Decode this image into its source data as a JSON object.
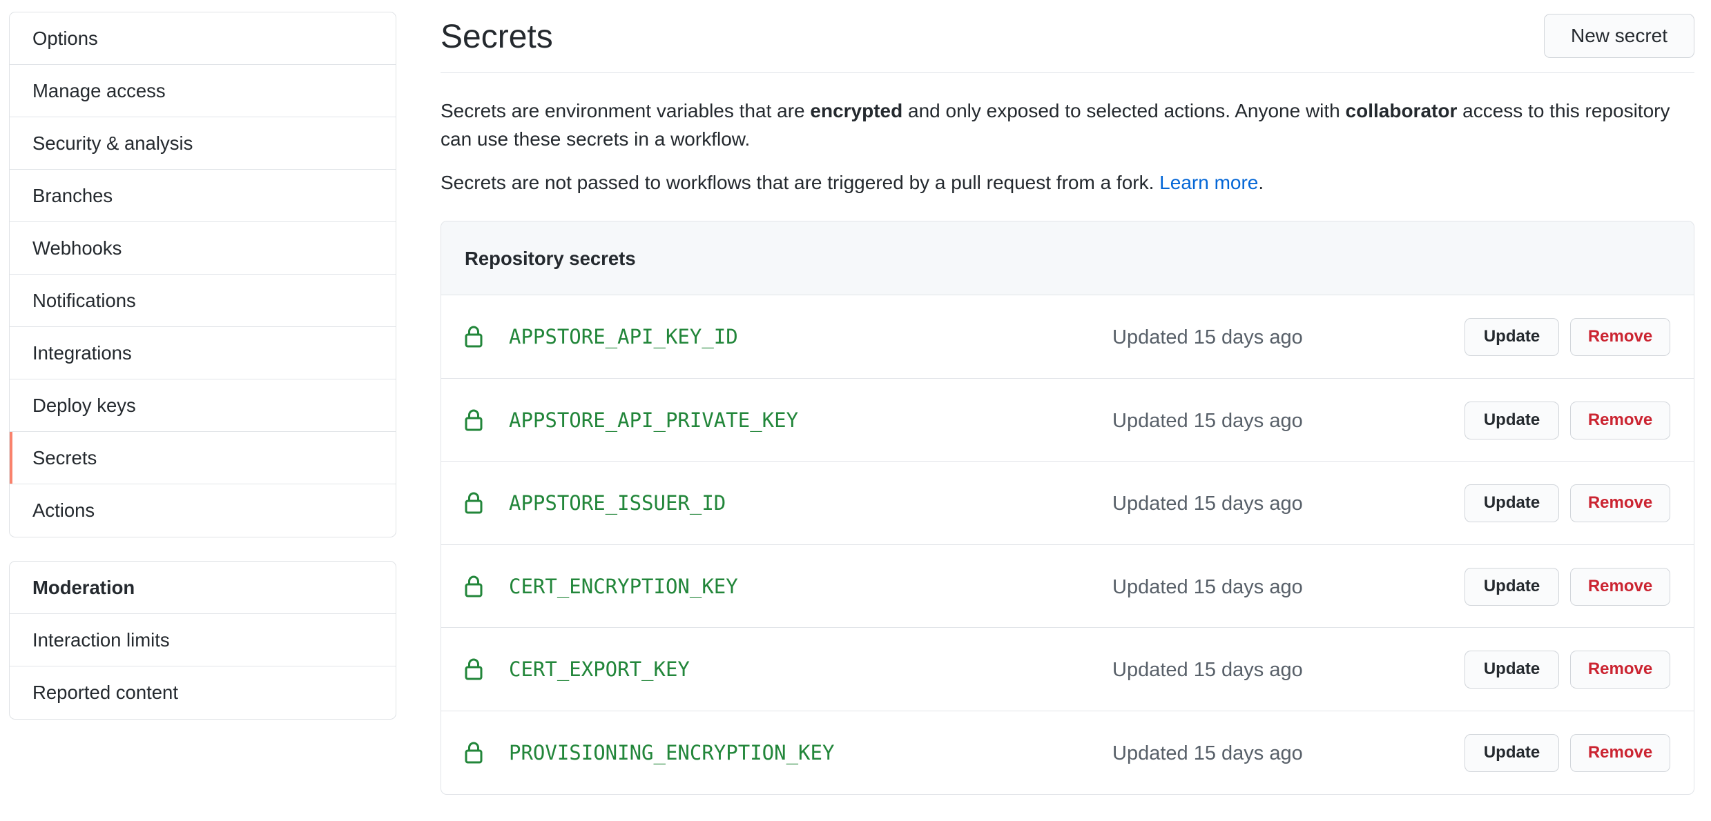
{
  "sidebar": {
    "settings_items": [
      {
        "label": "Options"
      },
      {
        "label": "Manage access"
      },
      {
        "label": "Security & analysis"
      },
      {
        "label": "Branches"
      },
      {
        "label": "Webhooks"
      },
      {
        "label": "Notifications"
      },
      {
        "label": "Integrations"
      },
      {
        "label": "Deploy keys"
      },
      {
        "label": "Secrets",
        "selected": true
      },
      {
        "label": "Actions"
      }
    ],
    "moderation": {
      "heading": "Moderation",
      "items": [
        {
          "label": "Interaction limits"
        },
        {
          "label": "Reported content"
        }
      ]
    }
  },
  "main": {
    "title": "Secrets",
    "new_button": "New secret",
    "description": {
      "p1_a": "Secrets are environment variables that are ",
      "p1_b": "encrypted",
      "p1_c": " and only exposed to selected actions. Anyone with ",
      "p1_d": "collaborator",
      "p1_e": " access to this repository can use these secrets in a workflow.",
      "p2_a": "Secrets are not passed to workflows that are triggered by a pull request from a fork. ",
      "p2_link": "Learn more",
      "p2_end": "."
    },
    "box_title": "Repository secrets",
    "update_label": "Update",
    "remove_label": "Remove",
    "secrets": [
      {
        "name": "APPSTORE_API_KEY_ID",
        "updated": "Updated 15 days ago"
      },
      {
        "name": "APPSTORE_API_PRIVATE_KEY",
        "updated": "Updated 15 days ago"
      },
      {
        "name": "APPSTORE_ISSUER_ID",
        "updated": "Updated 15 days ago"
      },
      {
        "name": "CERT_ENCRYPTION_KEY",
        "updated": "Updated 15 days ago"
      },
      {
        "name": "CERT_EXPORT_KEY",
        "updated": "Updated 15 days ago"
      },
      {
        "name": "PROVISIONING_ENCRYPTION_KEY",
        "updated": "Updated 15 days ago"
      }
    ]
  },
  "colors": {
    "selected_indicator": "#f9826c",
    "secret_name": "#22863a",
    "remove_text": "#cb2431",
    "link": "#0366d6"
  },
  "icons": {
    "secret_row": "lock-icon"
  }
}
